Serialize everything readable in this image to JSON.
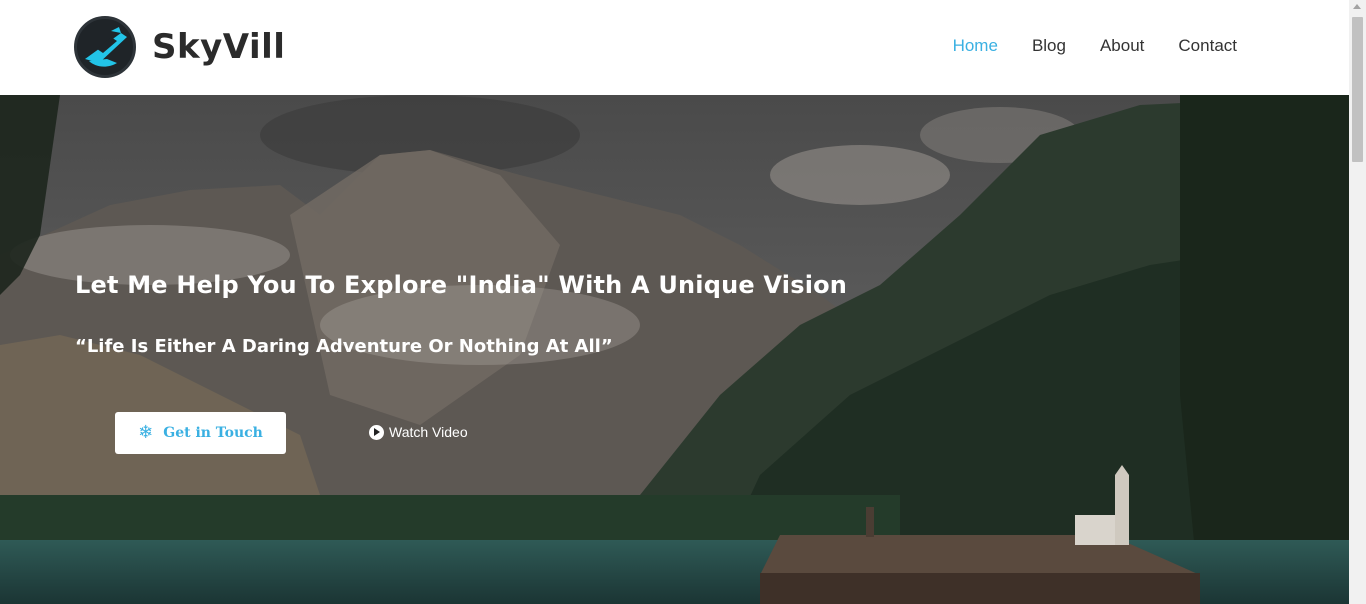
{
  "brand": {
    "name": "SkyVill",
    "logo_icon": "plane-logo-icon"
  },
  "nav": {
    "items": [
      {
        "label": "Home",
        "active": true
      },
      {
        "label": "Blog",
        "active": false
      },
      {
        "label": "About",
        "active": false
      },
      {
        "label": "Contact",
        "active": false
      }
    ]
  },
  "hero": {
    "title": "Let Me Help You To Explore \"India\" With A Unique Vision",
    "quote": "“Life Is Either A Daring Adventure Or Nothing At All”",
    "primary_button": {
      "label": "Get in Touch",
      "icon": "snowflake-icon"
    },
    "secondary_button": {
      "label": "Watch Video",
      "icon": "play-icon"
    }
  },
  "colors": {
    "accent": "#3ab0e2",
    "text_dark": "#2b2b2b",
    "white": "#ffffff"
  }
}
